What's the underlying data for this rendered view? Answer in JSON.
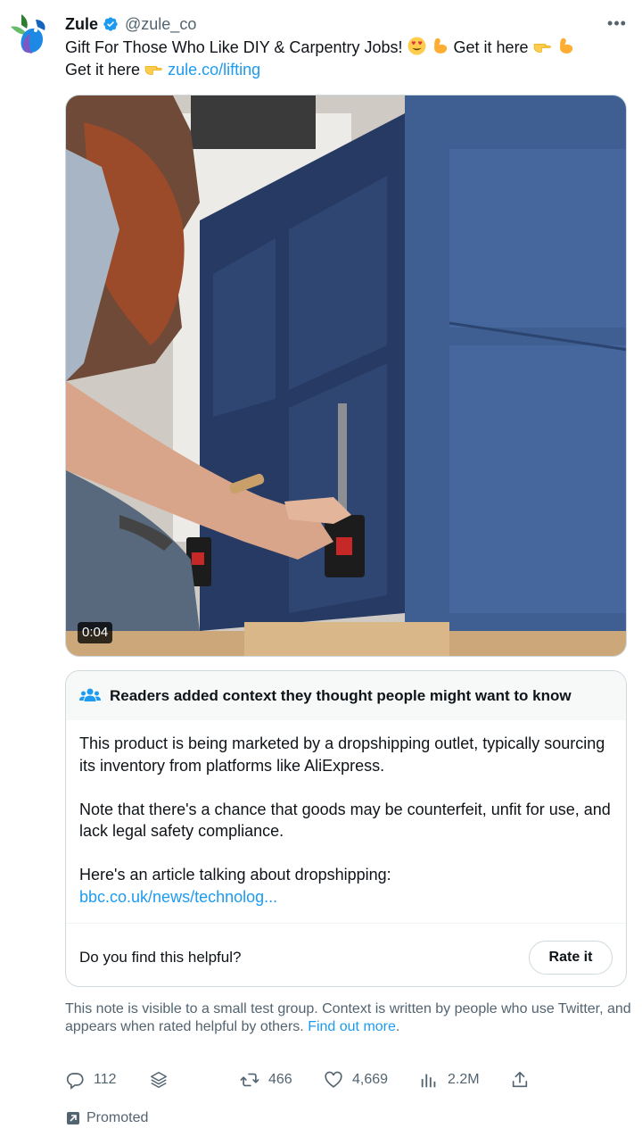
{
  "tweet": {
    "author_name": "Zule",
    "author_handle": "@zule_co",
    "text_line1": "Gift For Those Who Like DIY & Carpentry Jobs!",
    "text_line1_tail": "Get it here",
    "text_line2": "Get it here",
    "link": "zule.co/lifting",
    "video_duration": "0:04"
  },
  "note": {
    "title": "Readers added context they thought people might want to know",
    "paragraph1": "This product is being marketed by a dropshipping outlet, typically sourcing its inventory from platforms like AliExpress.",
    "paragraph2": "Note that there's a chance that goods may be counterfeit, unfit for use, and lack legal safety compliance.",
    "paragraph3": "Here's an article talking about dropshipping:",
    "article_link": "bbc.co.uk/news/technolog...",
    "question": "Do you find this helpful?",
    "rate_label": "Rate it"
  },
  "disclaimer": {
    "text": "This note is visible to a small test group. Context is written by people who use Twitter, and appears when rated helpful by others.",
    "link": "Find out more",
    "trailing": "."
  },
  "actions": {
    "replies": "112",
    "retweets": "466",
    "likes": "4,669",
    "views": "2.2M"
  },
  "promoted_label": "Promoted",
  "colors": {
    "link": "#1d9bf0",
    "muted": "#536471",
    "verified": "#1d9bf0"
  }
}
